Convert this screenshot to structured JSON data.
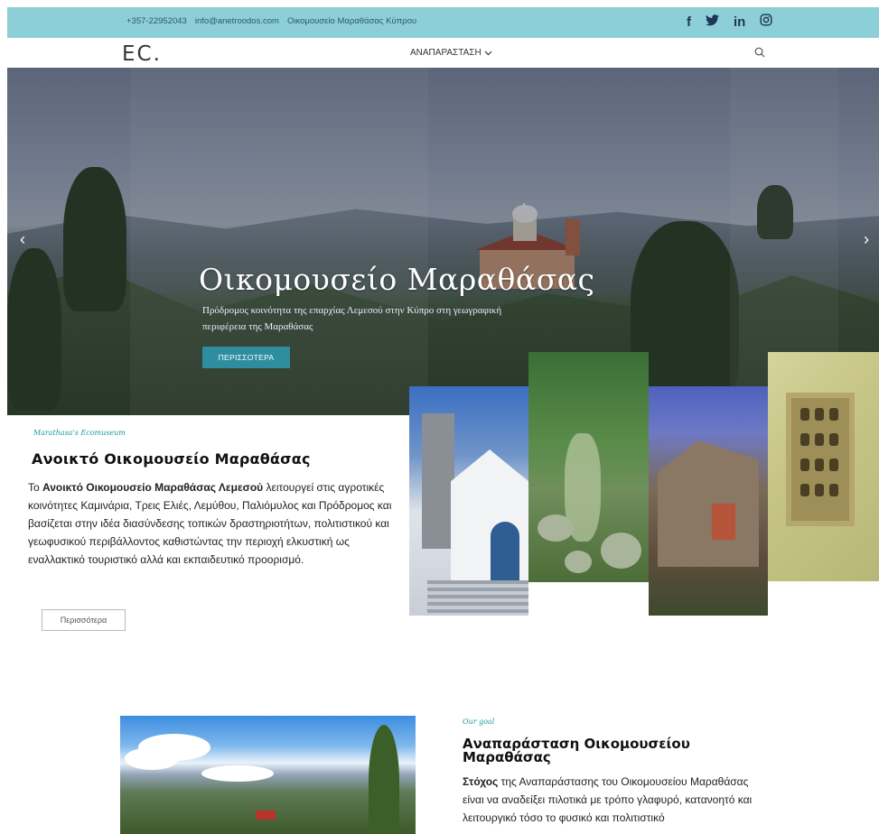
{
  "topbar": {
    "phone": "+357-22952043",
    "email": "info@anetroodos.com",
    "location": "Οικομουσείο Μαραθάσας Κύπρου",
    "social": [
      "f",
      "𝕪",
      "in",
      "◎"
    ]
  },
  "nav": {
    "logo": "EC.",
    "menu_label": "ΑΝΑΠΑΡΑΣΤΑΣΗ",
    "menu_chevron": "⌵"
  },
  "hero": {
    "title": "Οικομουσείο Μαραθάσας",
    "subtitle": "Πρόδρομος κοινότητα της επαρχίας Λεμεσού στην Κύπρο στη γεωγραφική περιφέρεια της Μαραθάσας",
    "button": "ΠΕΡΙΣΣΟΤΕΡΑ",
    "prev": "‹",
    "next": "›"
  },
  "about": {
    "kicker": "Marathasa's Ecomuseum",
    "heading": "Ανοικτό Οικομουσείο Μαραθάσας",
    "body_pre": "Το ",
    "body_bold": "Ανοικτό Οικομουσείο Μαραθάσας Λεμεσού",
    "body_post": " λειτουργεί στις αγροτικές κοινότητες Καμινάρια, Τρεις Ελιές, Λεμύθου, Παλιόμυλος και Πρόδρομος και βασίζεται στην ιδέα διασύνδεσης τοπικών δραστηριοτήτων, πολιτιστικού και γεωφυσικού περιβάλλοντος καθιστώντας την περιοχή ελκυστική ως εναλλακτικό τουριστικό αλλά και εκπαιδευτικό προορισμό.",
    "button": "Περισσότερα"
  },
  "goal": {
    "kicker": "Our goal",
    "heading": "Αναπαράσταση Οικομουσείου Μαραθάσας",
    "body_bold": "Στόχος",
    "body_post": " της Αναπαράστασης του Οικομουσείου Μαραθάσας είναι να αναδείξει πιλοτικά με τρόπο γλαφυρό, κατανοητό και λειτουργικό τόσο το φυσικό και πολιτιστικό"
  },
  "colors": {
    "topbar": "#8ccfd8",
    "accent": "#2f8da0",
    "kicker": "#1f9d9b"
  }
}
